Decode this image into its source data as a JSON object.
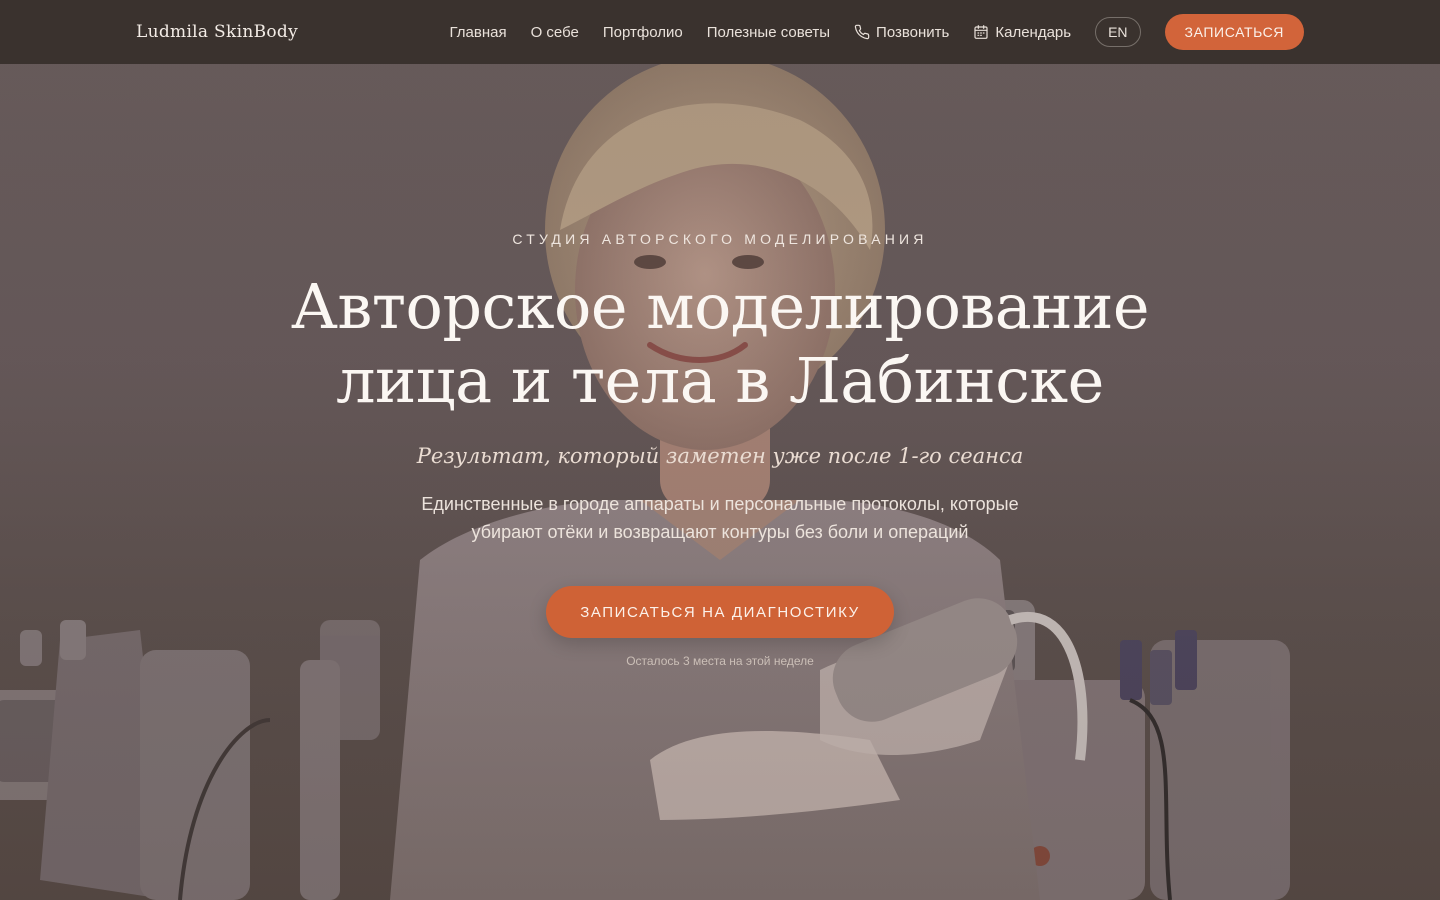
{
  "nav": {
    "logo": "Ludmila SkinBody",
    "links": [
      "Главная",
      "О себе",
      "Портфолио",
      "Полезные советы"
    ],
    "call_label": "Позвонить",
    "calendar_label": "Календарь",
    "lang_label": "EN",
    "cta_label": "ЗАПИСАТЬСЯ"
  },
  "hero": {
    "eyebrow": "СТУДИЯ АВТОРСКОГО МОДЕЛИРОВАНИЯ",
    "headline_line1": "Авторское моделирование",
    "headline_line2": "лица и тела в Лабинске",
    "tagline": "Результат, который заметен уже после 1-го сеанса",
    "desc_line1": "Единственные в городе аппараты и персональные протоколы, которые",
    "desc_line2": "убирают отёки и возвращают контуры без боли и операций",
    "cta_label": "ЗАПИСАТЬСЯ НА ДИАГНОСТИКУ",
    "availability_note": "Осталось 3 места на этой неделе"
  },
  "icons": {
    "phone": "phone-icon",
    "calendar": "calendar-icon"
  },
  "colors": {
    "nav_bg": "#3a322e",
    "accent": "#d2643a",
    "text_light": "#fbf7f3"
  }
}
